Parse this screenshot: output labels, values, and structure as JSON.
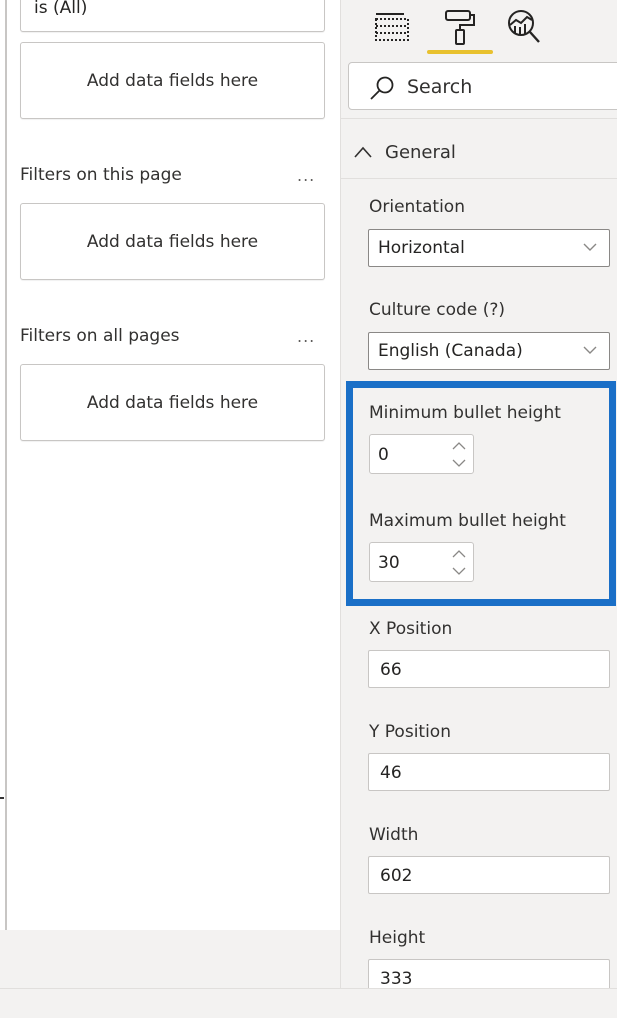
{
  "filters_pane": {
    "top_filter_text": "is (All)",
    "top_drop_zone": "Add data fields here",
    "page_section": {
      "title": "Filters on this page",
      "more": "...",
      "drop_zone": "Add data fields here"
    },
    "all_pages_section": {
      "title": "Filters on all pages",
      "more": "...",
      "drop_zone": "Add data fields here"
    }
  },
  "format_pane": {
    "tabs": [
      {
        "name": "fields",
        "icon": "fields-table-icon",
        "active": false
      },
      {
        "name": "format",
        "icon": "paint-roller-icon",
        "active": true
      },
      {
        "name": "analytics",
        "icon": "analytics-magnifier-icon",
        "active": false
      }
    ],
    "active_tab_color": "#e8c12e",
    "search": {
      "placeholder": "Search",
      "value": ""
    },
    "section": {
      "title": "General",
      "expanded": true
    },
    "properties": {
      "orientation": {
        "label": "Orientation",
        "value": "Horizontal"
      },
      "culture_code": {
        "label": "Culture code (?)",
        "value": "English (Canada)"
      },
      "min_bullet_height": {
        "label": "Minimum bullet height",
        "value": "0"
      },
      "max_bullet_height": {
        "label": "Maximum bullet height",
        "value": "30"
      },
      "x_position": {
        "label": "X Position",
        "value": "66"
      },
      "y_position": {
        "label": "Y Position",
        "value": "46"
      },
      "width": {
        "label": "Width",
        "value": "602"
      },
      "height": {
        "label": "Height",
        "value": "333"
      }
    },
    "highlight_color": "#1a6fc7"
  }
}
